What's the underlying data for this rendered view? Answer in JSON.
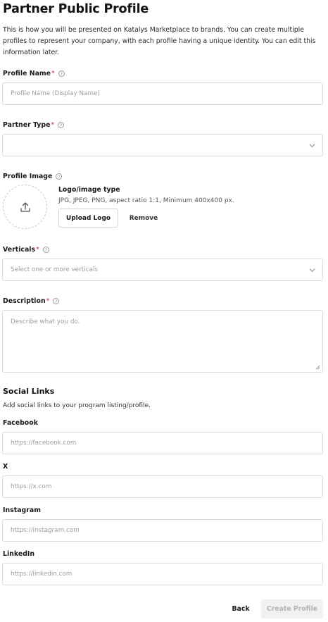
{
  "page": {
    "title": "Partner Public Profile",
    "intro": "This is how you will be presented on Katalys Marketplace to brands. You can create multiple profiles to represent your company, with each profile having a unique identity. You can edit this information later."
  },
  "profile_name": {
    "label": "Profile Name",
    "required": "*",
    "help_icon": "question-circle-icon",
    "value": "",
    "placeholder": "Profile Name (Display Name)"
  },
  "partner_type": {
    "label": "Partner Type",
    "required": "*",
    "help_icon": "question-circle-icon",
    "value": "",
    "dropdown_icon": "chevron-down-icon"
  },
  "profile_image": {
    "label": "Profile Image",
    "help_icon": "question-circle-icon",
    "upload_icon": "upload-icon",
    "heading": "Logo/image type",
    "hint": "JPG, JPEG, PNG, aspect ratio 1:1, Minimum 400x400 px.",
    "upload_label": "Upload Logo",
    "remove_label": "Remove"
  },
  "verticals": {
    "label": "Verticals",
    "required": "*",
    "help_icon": "question-circle-icon",
    "placeholder": "Select one or more verticals",
    "dropdown_icon": "chevron-down-icon"
  },
  "description": {
    "label": "Description",
    "required": "*",
    "help_icon": "question-circle-icon",
    "value": "",
    "placeholder": "Describe what you do."
  },
  "social": {
    "heading": "Social Links",
    "subheading": "Add social links to your program listing/profile.",
    "links": [
      {
        "label": "Facebook",
        "value": "",
        "placeholder": "https://facebook.com"
      },
      {
        "label": "X",
        "value": "",
        "placeholder": "https://x.com"
      },
      {
        "label": "Instagram",
        "value": "",
        "placeholder": "https://instagram.com"
      },
      {
        "label": "LinkedIn",
        "value": "",
        "placeholder": "https://linkedin.com"
      }
    ]
  },
  "actions": {
    "back_label": "Back",
    "create_label": "Create Profile"
  },
  "colors": {
    "required_marker": "#d9253b",
    "disabled_button_bg": "#f1f1f1",
    "disabled_button_text": "#b3b3b3",
    "border": "#dcdcdc"
  }
}
